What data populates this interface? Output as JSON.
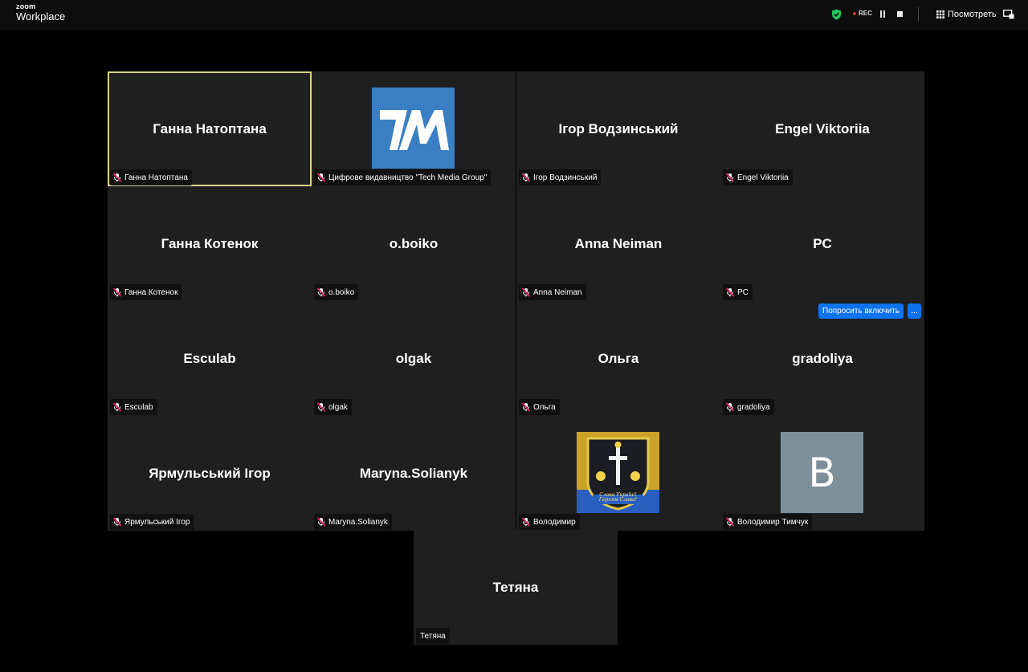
{
  "app": {
    "brand_small": "zoom",
    "brand_big": "Workplace"
  },
  "toolbar": {
    "rec_label": "REC",
    "view_label": "Посмотреть"
  },
  "participants": [
    {
      "name": "Ганна Натоптана",
      "label": "Ганна Натоптана",
      "muted": true,
      "active": true
    },
    {
      "name": "",
      "label": "Цифрове видавництво \"Tech Media Group\"",
      "muted": true,
      "avatar": "tmg-logo"
    },
    {
      "name": "Ігор Водзинський",
      "label": "Ігор Водзинський",
      "muted": true
    },
    {
      "name": "Engel Viktoriia",
      "label": "Engel Viktoriia",
      "muted": true
    },
    {
      "name": "Ганна Котенок",
      "label": "Ганна Котенок",
      "muted": true
    },
    {
      "name": "o.boiko",
      "label": "o.boiko",
      "muted": true
    },
    {
      "name": "Anna Neiman",
      "label": "Anna Neiman",
      "muted": true
    },
    {
      "name": "PC",
      "label": "PC",
      "muted": true
    },
    {
      "name": "Esculab",
      "label": "Esculab",
      "muted": true
    },
    {
      "name": "olgak",
      "label": "olgak",
      "muted": true
    },
    {
      "name": "Ольга",
      "label": "Ольга",
      "muted": true
    },
    {
      "name": "gradoliya",
      "label": "gradoliya",
      "muted": true
    },
    {
      "name": "Ярмульський Ігор",
      "label": "Ярмульський Ігор",
      "muted": true
    },
    {
      "name": "Maryna.Solianyk",
      "label": "Maryna.Solianyk",
      "muted": true
    },
    {
      "name": "",
      "label": "Володимир",
      "muted": true,
      "avatar": "crest",
      "crest_text": "Слава Україні! Героям Слава!"
    },
    {
      "name": "",
      "label": "Володимир Тимчук",
      "muted": true,
      "avatar": "letter",
      "avatar_letter": "В"
    },
    {
      "name": "Тетяна",
      "label": "Тетяна",
      "muted": false
    }
  ],
  "pc_actions": {
    "ask_unmute": "Попросить включить",
    "more": "..."
  },
  "colors": {
    "accent": "#0e72ed",
    "active_border": "#d6d68a",
    "tile_bg": "#1f1f1f",
    "mute_red": "#e0245e"
  }
}
